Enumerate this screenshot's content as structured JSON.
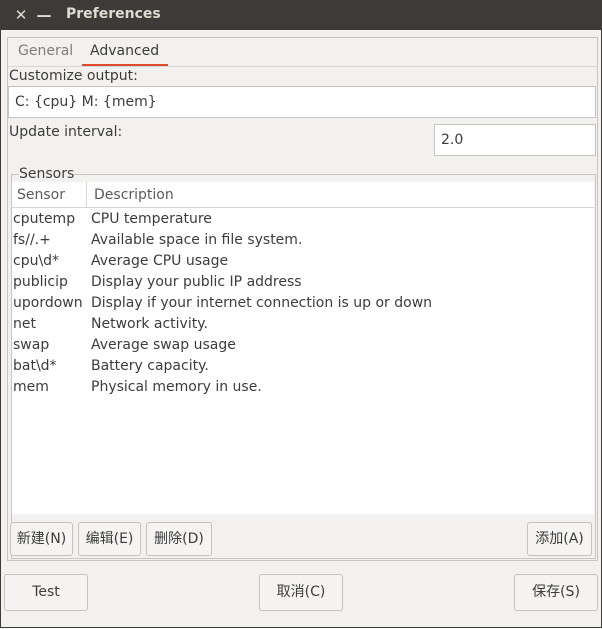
{
  "window": {
    "title": "Preferences",
    "close_symbol": "✕",
    "minimize_symbol": "—"
  },
  "tabs": [
    {
      "label": "General"
    },
    {
      "label": "Advanced",
      "active": true
    }
  ],
  "advanced": {
    "customize_label": "Customize output:",
    "customize_value": "C: {cpu} M: {mem}",
    "interval_label": "Update interval:",
    "interval_value": "2.0",
    "sensors_label": "Sensors",
    "columns": [
      "Sensor",
      "Description"
    ],
    "rows": [
      {
        "sensor": "cputemp",
        "description": "CPU temperature"
      },
      {
        "sensor": "fs//.+",
        "description": "Available space in file system."
      },
      {
        "sensor": "cpu\\d*",
        "description": "Average CPU usage"
      },
      {
        "sensor": "publicip",
        "description": "Display your public IP address"
      },
      {
        "sensor": "upordown",
        "description": "Display if your internet connection is up or down"
      },
      {
        "sensor": "net",
        "description": "Network activity."
      },
      {
        "sensor": "swap",
        "description": "Average swap usage"
      },
      {
        "sensor": "bat\\d*",
        "description": "Battery capacity."
      },
      {
        "sensor": "mem",
        "description": "Physical memory in use."
      }
    ],
    "buttons": {
      "new": "新建(N)",
      "edit": "编辑(E)",
      "delete": "删除(D)",
      "add": "添加(A)"
    }
  },
  "footer": {
    "test": "Test",
    "cancel": "取消(C)",
    "save": "保存(S)"
  },
  "colors": {
    "titlebar": "#3c3b37",
    "accent_underline": "#df4a2c",
    "background": "#f2f1f0"
  }
}
